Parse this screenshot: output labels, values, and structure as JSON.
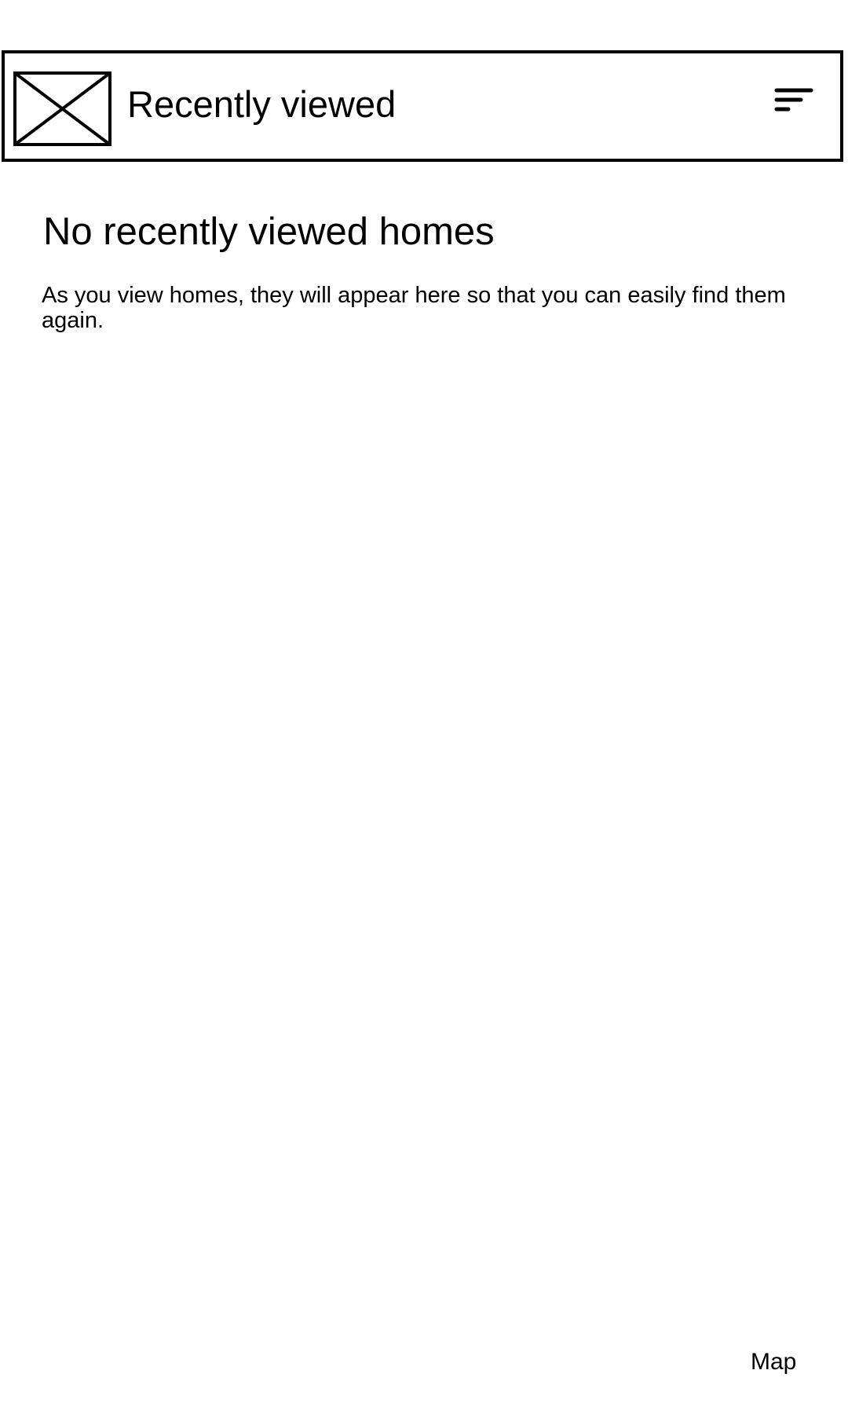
{
  "header": {
    "title": "Recently viewed",
    "image_icon": "image-placeholder-icon",
    "filter_icon": "sort-filter-icon"
  },
  "empty_state": {
    "title": "No recently viewed homes",
    "message": "As you view homes, they will appear here so that you can easily find them again."
  },
  "footer": {
    "map_label": "Map"
  }
}
